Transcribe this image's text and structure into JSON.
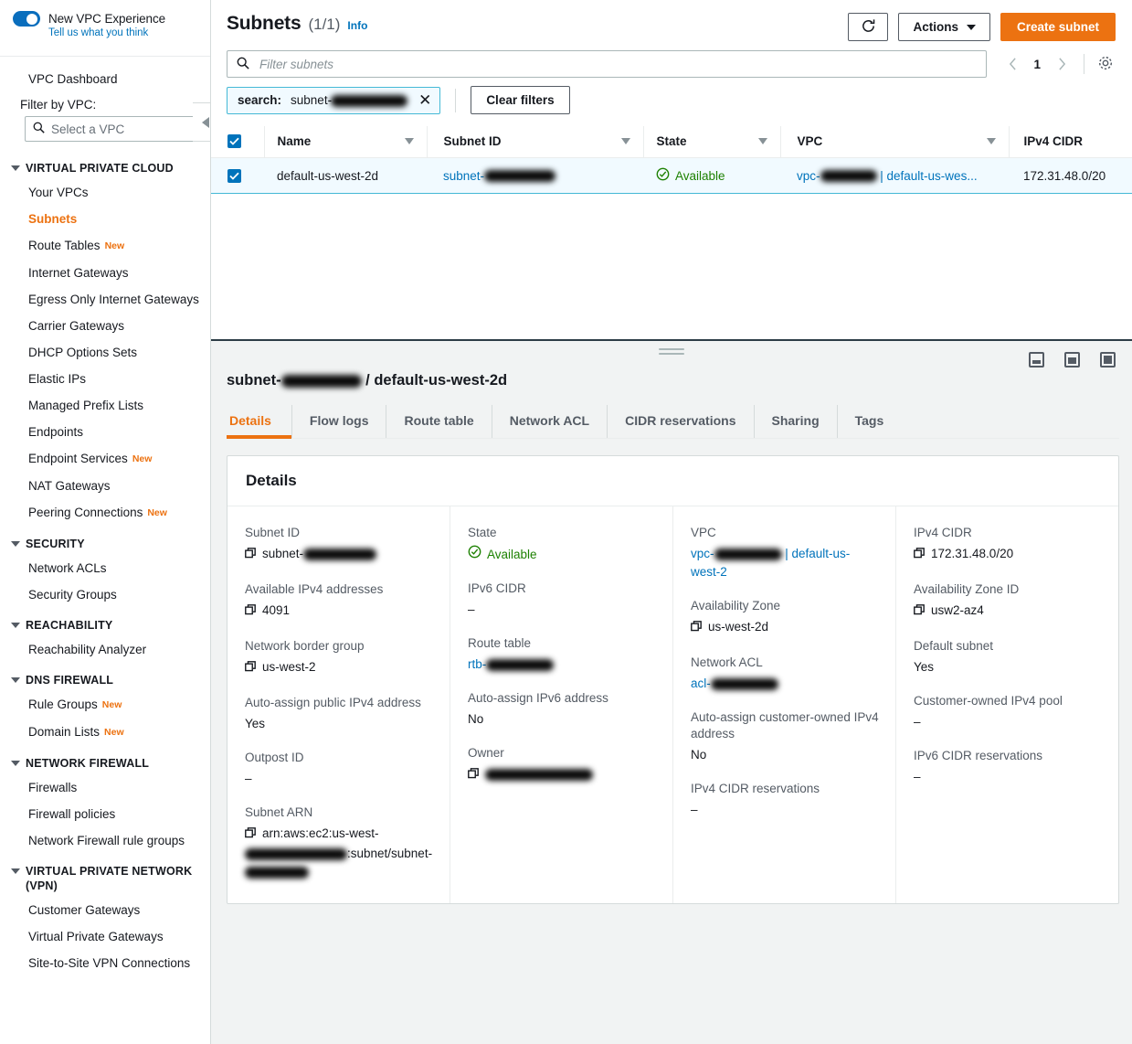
{
  "sidebar": {
    "toggle_label": "New VPC Experience",
    "feedback_link": "Tell us what you think",
    "dashboard": "VPC Dashboard",
    "filter_label": "Filter by VPC:",
    "vpc_select_placeholder": "Select a VPC",
    "groups": [
      {
        "title": "VIRTUAL PRIVATE CLOUD",
        "items": [
          {
            "label": "Your VPCs",
            "badge": "",
            "active": false
          },
          {
            "label": "Subnets",
            "badge": "",
            "active": true
          },
          {
            "label": "Route Tables",
            "badge": "New",
            "active": false
          },
          {
            "label": "Internet Gateways",
            "badge": "",
            "active": false
          },
          {
            "label": "Egress Only Internet Gateways",
            "badge": "",
            "active": false
          },
          {
            "label": "Carrier Gateways",
            "badge": "",
            "active": false
          },
          {
            "label": "DHCP Options Sets",
            "badge": "",
            "active": false
          },
          {
            "label": "Elastic IPs",
            "badge": "",
            "active": false
          },
          {
            "label": "Managed Prefix Lists",
            "badge": "",
            "active": false
          },
          {
            "label": "Endpoints",
            "badge": "",
            "active": false
          },
          {
            "label": "Endpoint Services",
            "badge": "New",
            "active": false
          },
          {
            "label": "NAT Gateways",
            "badge": "",
            "active": false
          },
          {
            "label": "Peering Connections",
            "badge": "New",
            "active": false
          }
        ]
      },
      {
        "title": "SECURITY",
        "items": [
          {
            "label": "Network ACLs",
            "badge": "",
            "active": false
          },
          {
            "label": "Security Groups",
            "badge": "",
            "active": false
          }
        ]
      },
      {
        "title": "REACHABILITY",
        "items": [
          {
            "label": "Reachability Analyzer",
            "badge": "",
            "active": false
          }
        ]
      },
      {
        "title": "DNS FIREWALL",
        "items": [
          {
            "label": "Rule Groups",
            "badge": "New",
            "active": false
          },
          {
            "label": "Domain Lists",
            "badge": "New",
            "active": false
          }
        ]
      },
      {
        "title": "NETWORK FIREWALL",
        "items": [
          {
            "label": "Firewalls",
            "badge": "",
            "active": false
          },
          {
            "label": "Firewall policies",
            "badge": "",
            "active": false
          },
          {
            "label": "Network Firewall rule groups",
            "badge": "",
            "active": false
          }
        ]
      },
      {
        "title": "VIRTUAL PRIVATE NETWORK (VPN)",
        "items": [
          {
            "label": "Customer Gateways",
            "badge": "",
            "active": false
          },
          {
            "label": "Virtual Private Gateways",
            "badge": "",
            "active": false
          },
          {
            "label": "Site-to-Site VPN Connections",
            "badge": "",
            "active": false
          }
        ]
      }
    ]
  },
  "header": {
    "title": "Subnets",
    "count": "(1/1)",
    "info": "Info",
    "refresh_icon": "refresh-icon",
    "actions_label": "Actions",
    "create_label": "Create subnet"
  },
  "search": {
    "placeholder": "Filter subnets",
    "search_icon": "search-icon",
    "token_key": "search:",
    "token_value": "subnet-",
    "token_redacted": true,
    "clear_label": "Clear filters",
    "page_number": "1",
    "gear_icon": "gear-icon"
  },
  "table": {
    "columns": [
      "Name",
      "Subnet ID",
      "State",
      "VPC",
      "IPv4 CIDR"
    ],
    "rows": [
      {
        "selected": true,
        "name": "default-us-west-2d",
        "subnet_id_prefix": "subnet-",
        "subnet_id_redacted": true,
        "state": "Available",
        "vpc_prefix": "vpc-",
        "vpc_suffix": " | default-us-wes...",
        "ipv4_cidr": "172.31.48.0/20"
      }
    ]
  },
  "split_panel": {
    "title_prefix": "subnet-",
    "title_suffix": " / default-us-west-2d",
    "tabs": [
      {
        "label": "Details",
        "active": true
      },
      {
        "label": "Flow logs",
        "active": false
      },
      {
        "label": "Route table",
        "active": false
      },
      {
        "label": "Network ACL",
        "active": false
      },
      {
        "label": "CIDR reservations",
        "active": false
      },
      {
        "label": "Sharing",
        "active": false
      },
      {
        "label": "Tags",
        "active": false
      }
    ],
    "card_title": "Details",
    "columns": [
      [
        {
          "label": "Subnet ID",
          "value": "subnet-",
          "copy": true,
          "redacted": true,
          "type": "text"
        },
        {
          "label": "Available IPv4 addresses",
          "value": "4091",
          "copy": true,
          "redacted": false,
          "type": "text"
        },
        {
          "label": "Network border group",
          "value": "us-west-2",
          "copy": true,
          "redacted": false,
          "type": "text"
        },
        {
          "label": "Auto-assign public IPv4 address",
          "value": "Yes",
          "copy": false,
          "redacted": false,
          "type": "text"
        },
        {
          "label": "Outpost ID",
          "value": "–",
          "copy": false,
          "redacted": false,
          "type": "text"
        },
        {
          "label": "Subnet ARN",
          "value": "arn:aws:ec2:us-west-",
          "value2": ":subnet/subnet-",
          "copy": true,
          "redacted": true,
          "type": "arn"
        }
      ],
      [
        {
          "label": "State",
          "value": "Available",
          "copy": false,
          "redacted": false,
          "type": "status"
        },
        {
          "label": "IPv6 CIDR",
          "value": "–",
          "copy": false,
          "redacted": false,
          "type": "text"
        },
        {
          "label": "Route table",
          "value": "rtb-",
          "copy": false,
          "redacted": true,
          "type": "link"
        },
        {
          "label": "Auto-assign IPv6 address",
          "value": "No",
          "copy": false,
          "redacted": false,
          "type": "text"
        },
        {
          "label": "Owner",
          "value": "",
          "copy": true,
          "redacted": true,
          "type": "text"
        }
      ],
      [
        {
          "label": "VPC",
          "value": "vpc-",
          "value2": " | default-us-west-2",
          "copy": false,
          "redacted": true,
          "type": "link"
        },
        {
          "label": "Availability Zone",
          "value": "us-west-2d",
          "copy": true,
          "redacted": false,
          "type": "text"
        },
        {
          "label": "Network ACL",
          "value": "acl-",
          "copy": false,
          "redacted": true,
          "type": "link"
        },
        {
          "label": "Auto-assign customer-owned IPv4 address",
          "value": "No",
          "copy": false,
          "redacted": false,
          "type": "text"
        },
        {
          "label": "IPv4 CIDR reservations",
          "value": "–",
          "copy": false,
          "redacted": false,
          "type": "text"
        }
      ],
      [
        {
          "label": "IPv4 CIDR",
          "value": "172.31.48.0/20",
          "copy": true,
          "redacted": false,
          "type": "text"
        },
        {
          "label": "Availability Zone ID",
          "value": "usw2-az4",
          "copy": true,
          "redacted": false,
          "type": "text"
        },
        {
          "label": "Default subnet",
          "value": "Yes",
          "copy": false,
          "redacted": false,
          "type": "text"
        },
        {
          "label": "Customer-owned IPv4 pool",
          "value": "–",
          "copy": false,
          "redacted": false,
          "type": "text"
        },
        {
          "label": "IPv6 CIDR reservations",
          "value": "–",
          "copy": false,
          "redacted": false,
          "type": "text"
        }
      ]
    ]
  },
  "colors": {
    "accent_orange": "#ec7211",
    "link_blue": "#0073bb",
    "success_green": "#1d8102",
    "selected_row": "#f1faff",
    "page_bg": "#f1f3f3"
  }
}
